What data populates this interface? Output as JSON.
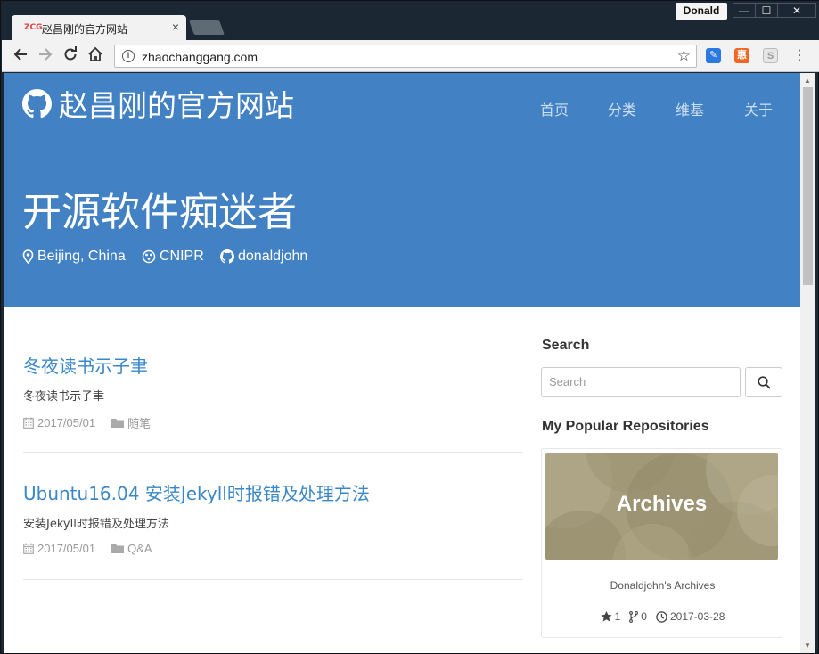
{
  "browser": {
    "tab_title": "赵昌刚的官方网站",
    "tab_favicon": "ZCG",
    "tab_close": "×",
    "profile_name": "Donald",
    "url": "zhaochanggang.com",
    "window_buttons": {
      "minimize": "—",
      "maximize": "☐",
      "close": "✕"
    },
    "icons": {
      "back": "back-arrow-icon",
      "forward": "forward-arrow-icon",
      "reload": "reload-icon",
      "home": "home-icon",
      "info": "info-icon",
      "bookmark": "star-icon",
      "menu": "menu-dots-icon"
    }
  },
  "site": {
    "brand_title": "赵昌刚的官方网站",
    "nav": [
      "首页",
      "分类",
      "维基",
      "关于"
    ],
    "hero_title": "开源软件痴迷者",
    "meta": {
      "location": "Beijing, China",
      "org": "CNIPR",
      "github": "donaldjohn"
    },
    "accent_color": "#4181c4",
    "link_color": "#3a87c8"
  },
  "posts": [
    {
      "title": "冬夜读书示子聿",
      "excerpt": "冬夜读书示子聿",
      "date": "2017/05/01",
      "category": "随笔"
    },
    {
      "title": "Ubuntu16.04 安装Jekyll时报错及处理方法",
      "excerpt": "安装Jekyll时报错及处理方法",
      "date": "2017/05/01",
      "category": "Q&A"
    }
  ],
  "sidebar": {
    "search_heading": "Search",
    "search_placeholder": "Search",
    "repos_heading": "My Popular Repositories",
    "repo": {
      "banner_title": "Archives",
      "description": "Donaldjohn's Archives",
      "stars": "1",
      "forks": "0",
      "updated": "2017-03-28"
    }
  }
}
